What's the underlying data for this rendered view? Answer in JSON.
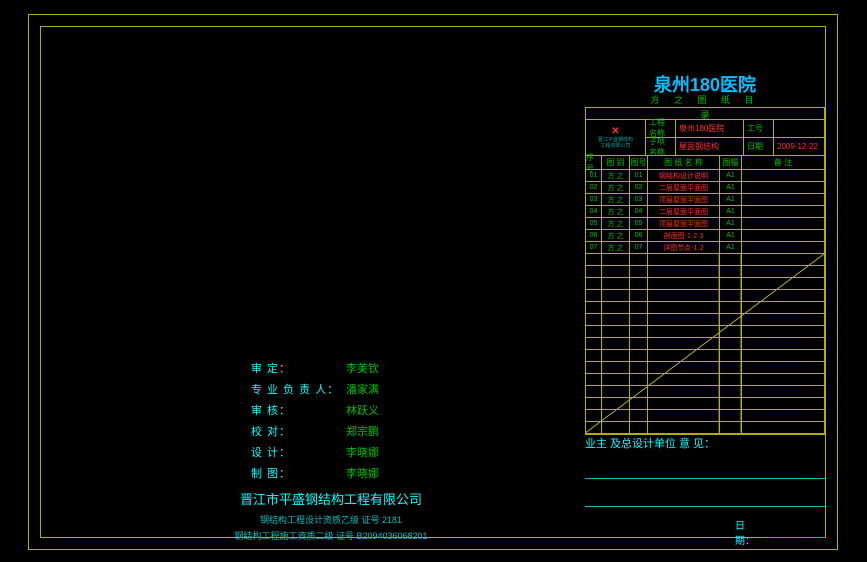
{
  "title": "泉州180医院",
  "subtitle": "方 之 图 纸 目",
  "subtitle_catalog": "录",
  "header": {
    "logo_mark": "✕",
    "logo_sub1": "晋江平盛钢结构",
    "logo_sub2": "工程有限公司",
    "proj_lab": "工程名称",
    "proj_val": "泉州180医院",
    "no_lab": "工号",
    "no_val": "",
    "sub_lab": "子项名称",
    "sub_val": "屋面钢结构",
    "date_lab": "日期",
    "date_val": "2009-12-22"
  },
  "thead": {
    "c1": "序号",
    "c2": "图 别",
    "c3": "图号",
    "c4": "图 纸 名 称",
    "c5": "图幅",
    "c6": "备  注"
  },
  "rows": [
    {
      "n": "01",
      "k": "方 之",
      "g": "01",
      "name": "钢结构设计说明",
      "f": "A1"
    },
    {
      "n": "02",
      "k": "方 之",
      "g": "02",
      "name": "二层屋面平面图",
      "f": "A1"
    },
    {
      "n": "03",
      "k": "方 之",
      "g": "03",
      "name": "顶层屋面平面图",
      "f": "A1"
    },
    {
      "n": "04",
      "k": "方 之",
      "g": "04",
      "name": "二层屋面平面图",
      "f": "A1"
    },
    {
      "n": "05",
      "k": "方 之",
      "g": "05",
      "name": "顶层屋面平面图",
      "f": "A1"
    },
    {
      "n": "06",
      "k": "方 之",
      "g": "06",
      "name": "剖面图-1·2·3",
      "f": "A1"
    },
    {
      "n": "07",
      "k": "方 之",
      "g": "07",
      "name": "详图节点-1·2",
      "f": "A1"
    }
  ],
  "signatures": [
    {
      "lab": "审        定：",
      "val": "李美钦"
    },
    {
      "lab": "专 业 负 责 人：",
      "val": "潘家满"
    },
    {
      "lab": "审        核：",
      "val": "林跃义"
    },
    {
      "lab": "校        对：",
      "val": "郑宗鹏"
    },
    {
      "lab": "设        计：",
      "val": "李晓娜"
    },
    {
      "lab": "制        图：",
      "val": "李晓娜"
    }
  ],
  "company": {
    "name": "晋江市平盛钢结构工程有限公司",
    "line1": "钢结构工程设计资质乙级  证号  2181",
    "line2": "钢结构工程施工资质二级  证号 B2094036068201"
  },
  "owner": {
    "label": "业主 及总设计单位 意 见：",
    "date_label": "日 期："
  },
  "chart_data": {
    "type": "table",
    "title": "泉州180医院 方之图纸目录",
    "columns": [
      "序号",
      "图别",
      "图号",
      "图纸名称",
      "图幅",
      "备注"
    ],
    "rows": [
      [
        "01",
        "方之",
        "01",
        "钢结构设计说明",
        "A1",
        ""
      ],
      [
        "02",
        "方之",
        "02",
        "二层屋面平面图",
        "A1",
        ""
      ],
      [
        "03",
        "方之",
        "03",
        "顶层屋面平面图",
        "A1",
        ""
      ],
      [
        "04",
        "方之",
        "04",
        "二层屋面平面图",
        "A1",
        ""
      ],
      [
        "05",
        "方之",
        "05",
        "顶层屋面平面图",
        "A1",
        ""
      ],
      [
        "06",
        "方之",
        "06",
        "剖面图-1·2·3",
        "A1",
        ""
      ],
      [
        "07",
        "方之",
        "07",
        "详图节点-1·2",
        "A1",
        ""
      ]
    ]
  }
}
